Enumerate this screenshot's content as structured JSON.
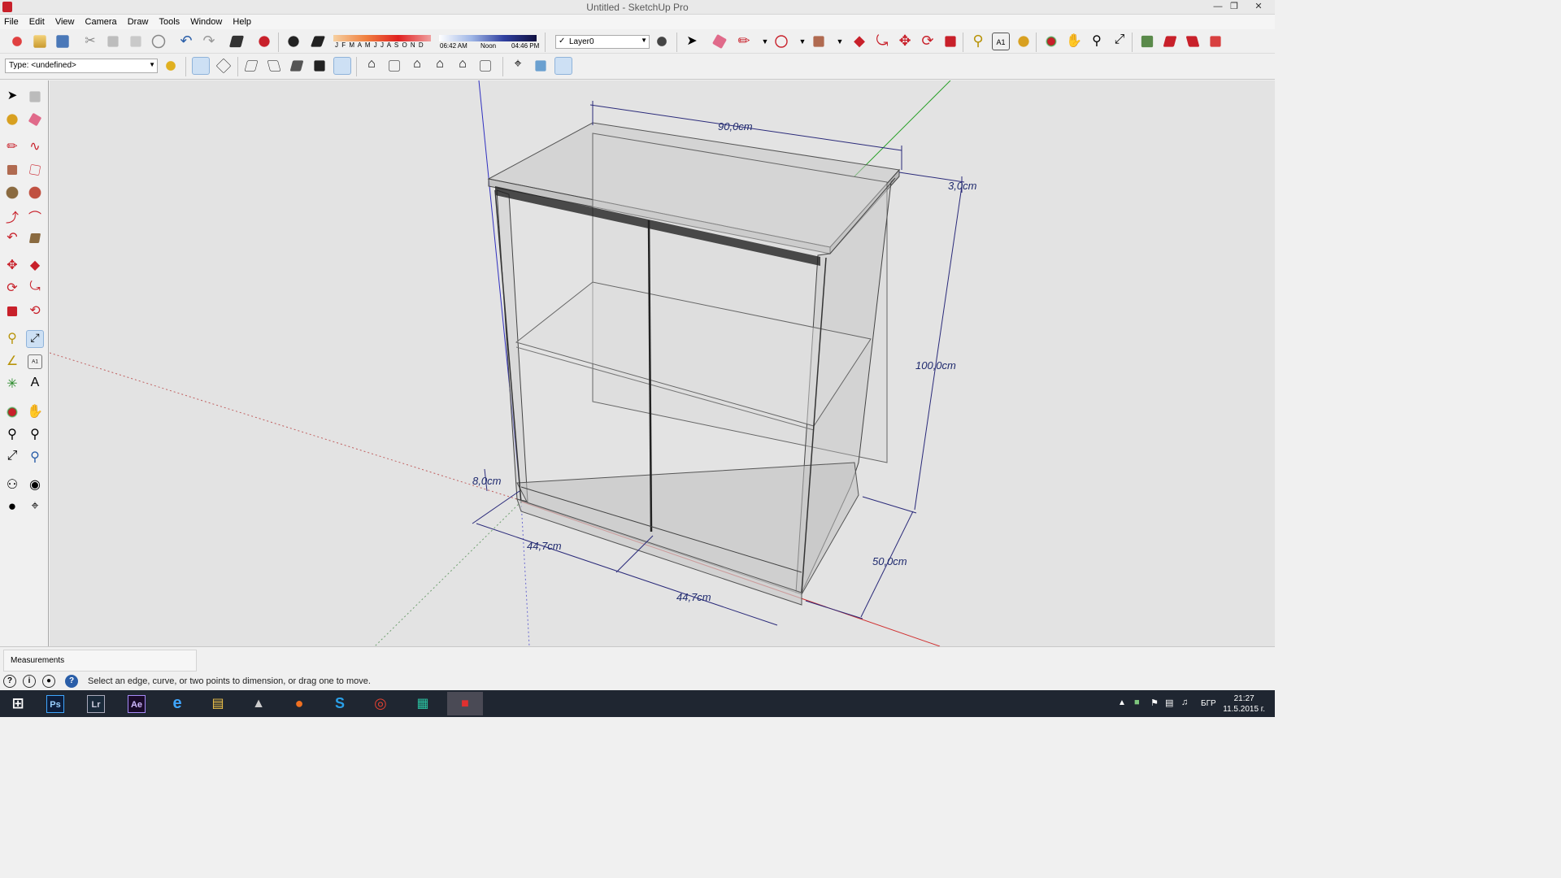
{
  "window": {
    "title": "Untitled - SketchUp Pro"
  },
  "menu": [
    "File",
    "Edit",
    "View",
    "Camera",
    "Draw",
    "Tools",
    "Window",
    "Help"
  ],
  "shadow": {
    "months": "J F M A M J J A S O N D",
    "time_start": "06:42 AM",
    "time_mid": "Noon",
    "time_end": "04:46 PM"
  },
  "layer": {
    "name": "Layer0"
  },
  "style_type": {
    "value": "Type: <undefined>"
  },
  "dimensions": {
    "width": "90,0cm",
    "top_thickness": "3,0cm",
    "height": "100,0cm",
    "plinth": "8,0cm",
    "door_left": "44,7cm",
    "door_right": "44,7cm",
    "depth": "50,0cm"
  },
  "measurements": {
    "label": "Measurements"
  },
  "status": {
    "text": "Select an edge, curve, or two points to dimension, or drag one to move."
  },
  "taskbar": {
    "apps": [
      "Ps",
      "Lr",
      "Ae"
    ],
    "lang": "БГР",
    "time": "21:27",
    "date": "11.5.2015 г."
  },
  "colors": {
    "accent": "#c8202a",
    "dimension": "#1f2a6e",
    "axis_red": "#d03030",
    "axis_green": "#2aa02a",
    "axis_blue": "#3030c0"
  }
}
